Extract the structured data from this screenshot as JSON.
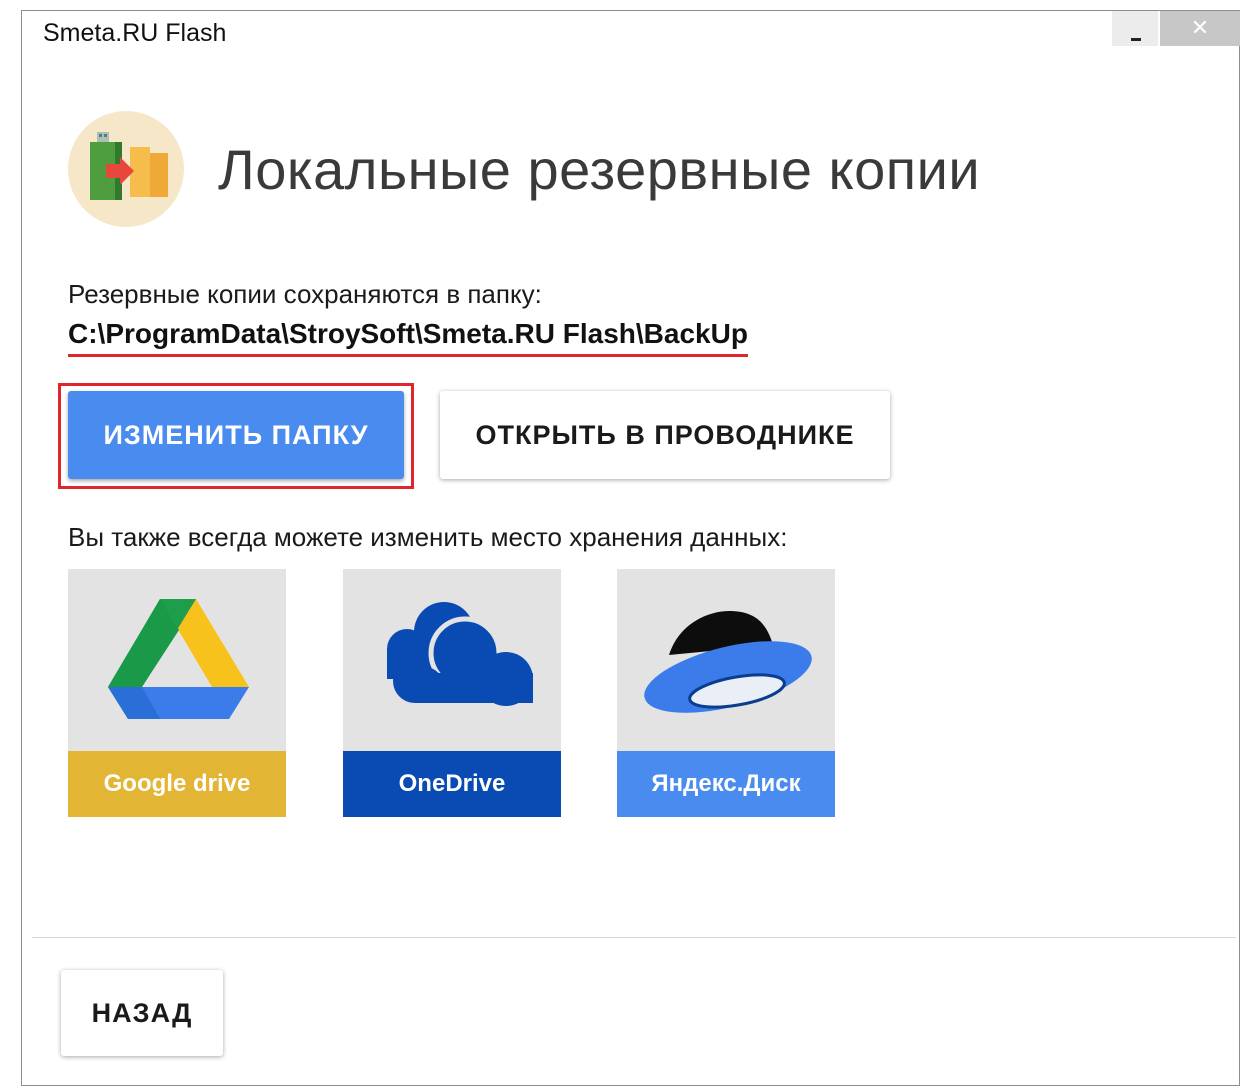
{
  "window": {
    "title": "Smeta.RU Flash",
    "minimize_symbol": "",
    "close_symbol": "✕"
  },
  "header": {
    "icon": "usb-to-folder-icon",
    "title": "Локальные резервные копии"
  },
  "backup": {
    "caption": "Резервные копии сохраняются в папку:",
    "path": "C:\\ProgramData\\StroySoft\\Smeta.RU Flash\\BackUp",
    "change_button": "ИЗМЕНИТЬ ПАПКУ",
    "open_button": "ОТКРЫТЬ В ПРОВОДНИКЕ"
  },
  "storage": {
    "caption": "Вы также всегда можете изменить место хранения данных:",
    "options": [
      {
        "label": "Google drive",
        "icon": "google-drive-icon",
        "color": "#e2b534"
      },
      {
        "label": "OneDrive",
        "icon": "onedrive-icon",
        "color": "#0a4bb3"
      },
      {
        "label": "Яндекс.Диск",
        "icon": "yandex-disk-icon",
        "color": "#4a8bef"
      }
    ]
  },
  "footer": {
    "back_button": "НАЗАД"
  },
  "colors": {
    "accent_blue": "#4a8bef",
    "highlight_red": "#e0262b"
  }
}
